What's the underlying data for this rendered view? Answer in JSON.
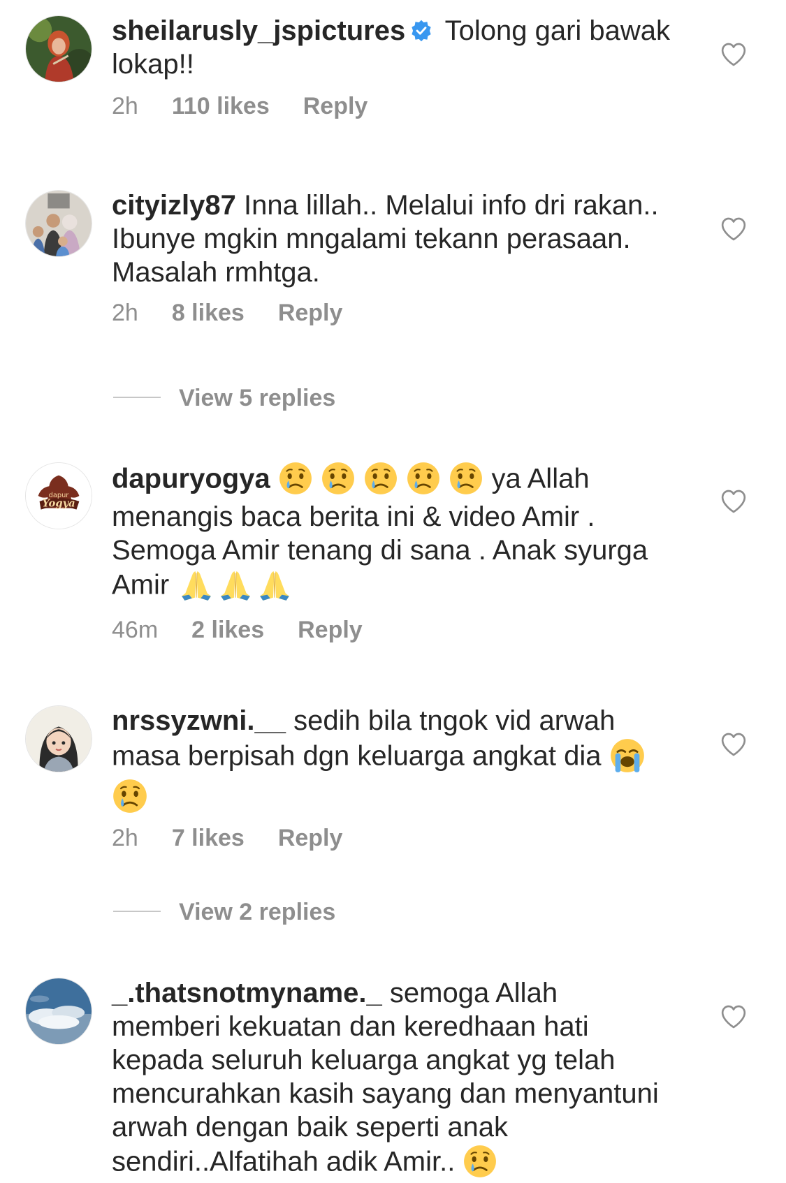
{
  "comments": [
    {
      "username": "sheilarusly_jspictures",
      "verified": true,
      "text_parts": [
        "Tolong gari bawak lokap!!"
      ],
      "time": "2h",
      "likes": "110 likes",
      "reply": "Reply"
    },
    {
      "username": "cityizly87",
      "verified": false,
      "text_parts": [
        "Inna lillah.. Melalui info dri rakan.. Ibunye mgkin mngalami tekann perasaan. Masalah rmhtga."
      ],
      "time": "2h",
      "likes": "8 likes",
      "reply": "Reply"
    },
    {
      "username": "dapuryogya",
      "verified": false,
      "text_parts": [
        "ya Allah menangis baca berita ini & video Amir . Semoga Amir tenang di sana . Anak syurga Amir"
      ],
      "time": "46m",
      "likes": "2 likes",
      "reply": "Reply"
    },
    {
      "username": "nrssyzwni.__",
      "verified": false,
      "text_parts": [
        "sedih bila tngok vid arwah masa berpisah dgn keluarga angkat dia"
      ],
      "time": "2h",
      "likes": "7 likes",
      "reply": "Reply"
    },
    {
      "username": "_.thatsnotmyname._",
      "verified": false,
      "text_parts": [
        "semoga Allah memberi kekuatan dan keredhaan hati kepada seluruh keluarga angkat yg telah mencurahkan kasih sayang dan menyantuni arwah dengan baik seperti anak sendiri..Alfatihah adik Amir.."
      ],
      "time": "",
      "likes": "",
      "reply": ""
    }
  ],
  "view_replies": [
    {
      "label": "View 5 replies"
    },
    {
      "label": "View 2 replies"
    }
  ],
  "icons": {
    "like": "heart-outline-icon",
    "verified": "verified-badge-icon",
    "emoji_cry": "crying-face-emoji",
    "emoji_sob": "loudly-crying-face-emoji",
    "emoji_pray": "folded-hands-emoji"
  },
  "colors": {
    "text": "#262626",
    "secondary": "#8e8e8e",
    "verified": "#3897f0",
    "divider": "#c7c7c7"
  }
}
